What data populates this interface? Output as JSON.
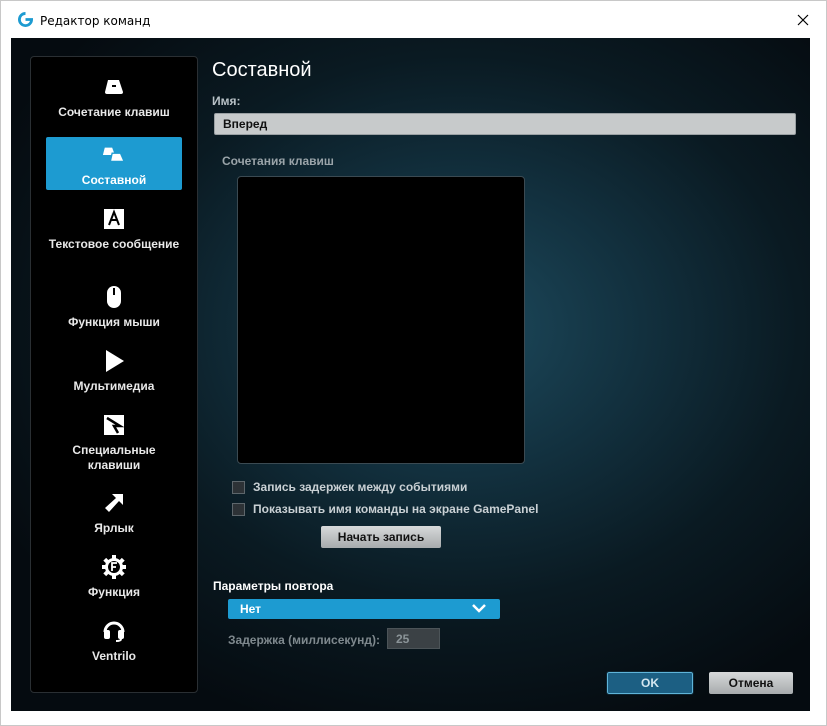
{
  "window": {
    "title": "Редактор команд",
    "close_glyph": "✕",
    "app_icon": "logitech-g-icon",
    "accent_color": "#1d9bd1"
  },
  "sidebar": {
    "items": [
      {
        "label": "Сочетание клавиш",
        "icon": "keystroke-icon",
        "active": false
      },
      {
        "label": "Составной",
        "icon": "multikey-icon",
        "active": true
      },
      {
        "label": "Текстовое сообщение",
        "icon": "text-block-icon",
        "active": false
      },
      {
        "label": "Функция мыши",
        "icon": "mouse-icon",
        "active": false
      },
      {
        "label": "Мультимедиа",
        "icon": "play-icon",
        "active": false
      },
      {
        "label": "Специальные клавиши",
        "icon": "hotkey-icon",
        "active": false
      },
      {
        "label": "Ярлык",
        "icon": "shortcut-arrow-icon",
        "active": false
      },
      {
        "label": "Функция",
        "icon": "function-gear-icon",
        "active": false
      },
      {
        "label": "Ventrilo",
        "icon": "headset-icon",
        "active": false
      }
    ]
  },
  "editor": {
    "heading": "Составной",
    "name_label": "Имя:",
    "name_value": "Вперед",
    "keystrokes_label": "Сочетания клавиш",
    "record_delays_label": "Запись задержек между событиями",
    "show_name_label": "Показывать имя команды на экране GamePanel",
    "record_delays_checked": false,
    "show_name_checked": false,
    "start_record_button": "Начать запись"
  },
  "repeat": {
    "label": "Параметры повтора",
    "selected": "Нет",
    "delay_label": "Задержка (миллисекунд):",
    "delay_value": "25"
  },
  "footer": {
    "ok": "OK",
    "cancel": "Отмена"
  }
}
